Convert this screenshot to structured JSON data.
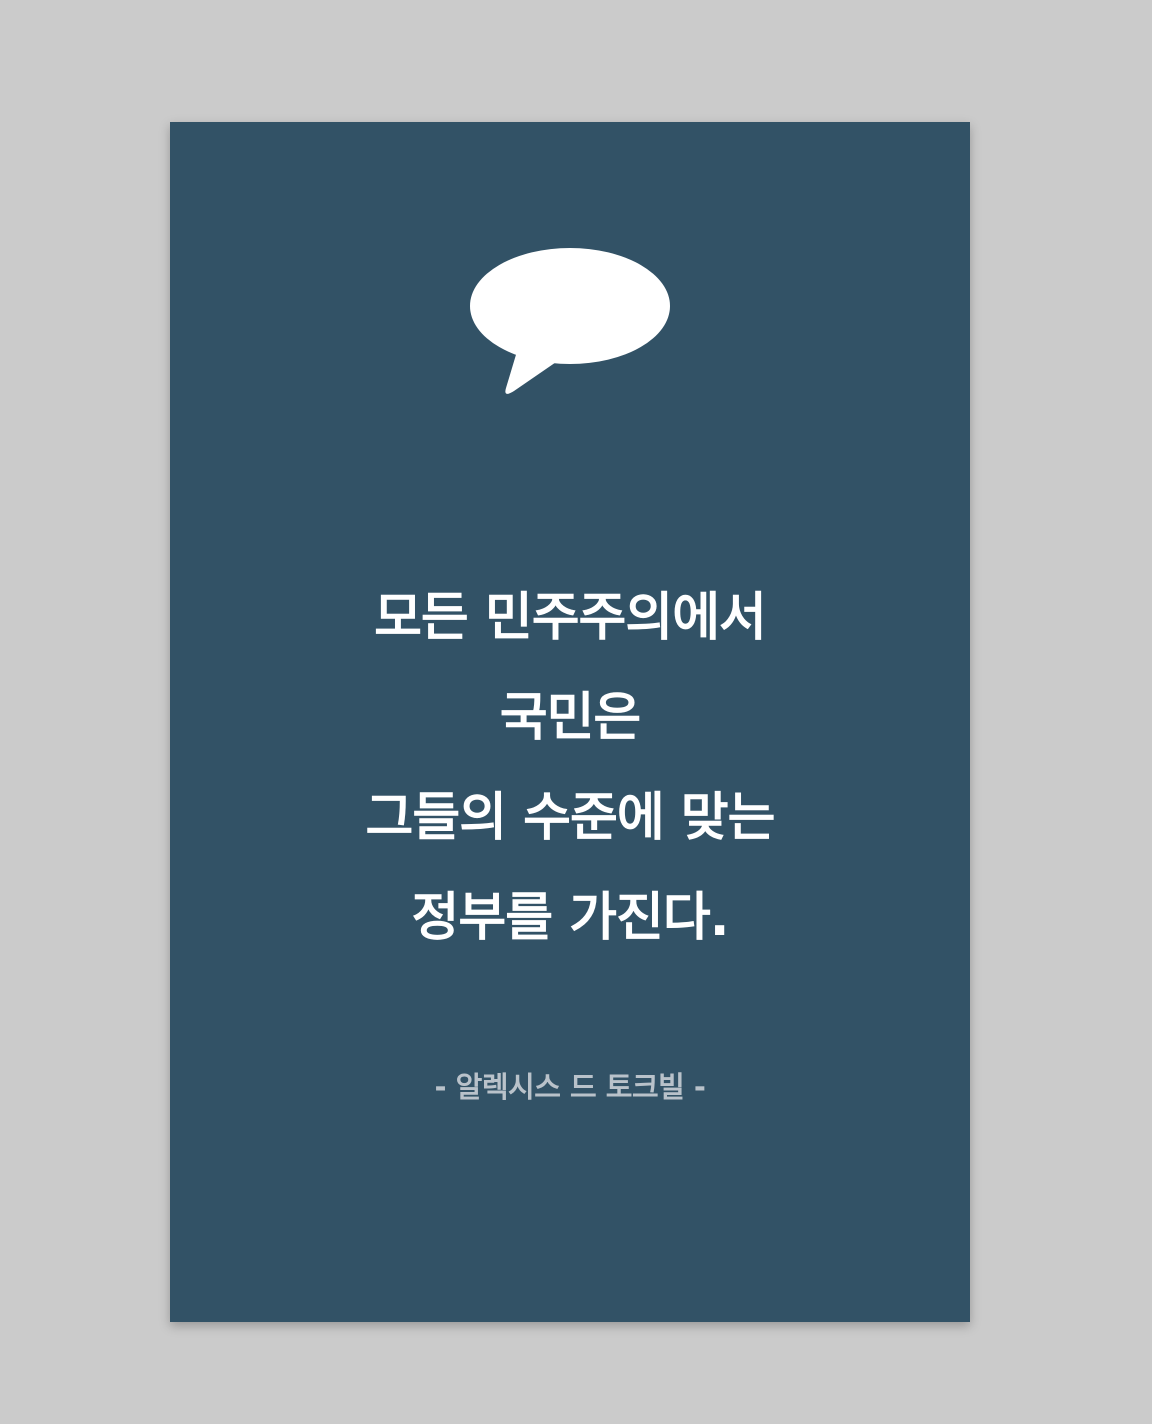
{
  "card": {
    "background_color": "#325266",
    "icon": "speech-bubble-icon",
    "quote_lines": [
      "모든 민주주의에서",
      "국민은",
      "그들의 수준에 맞는",
      "정부를 가진다."
    ],
    "author": "- 알렉시스 드 토크빌 -"
  }
}
